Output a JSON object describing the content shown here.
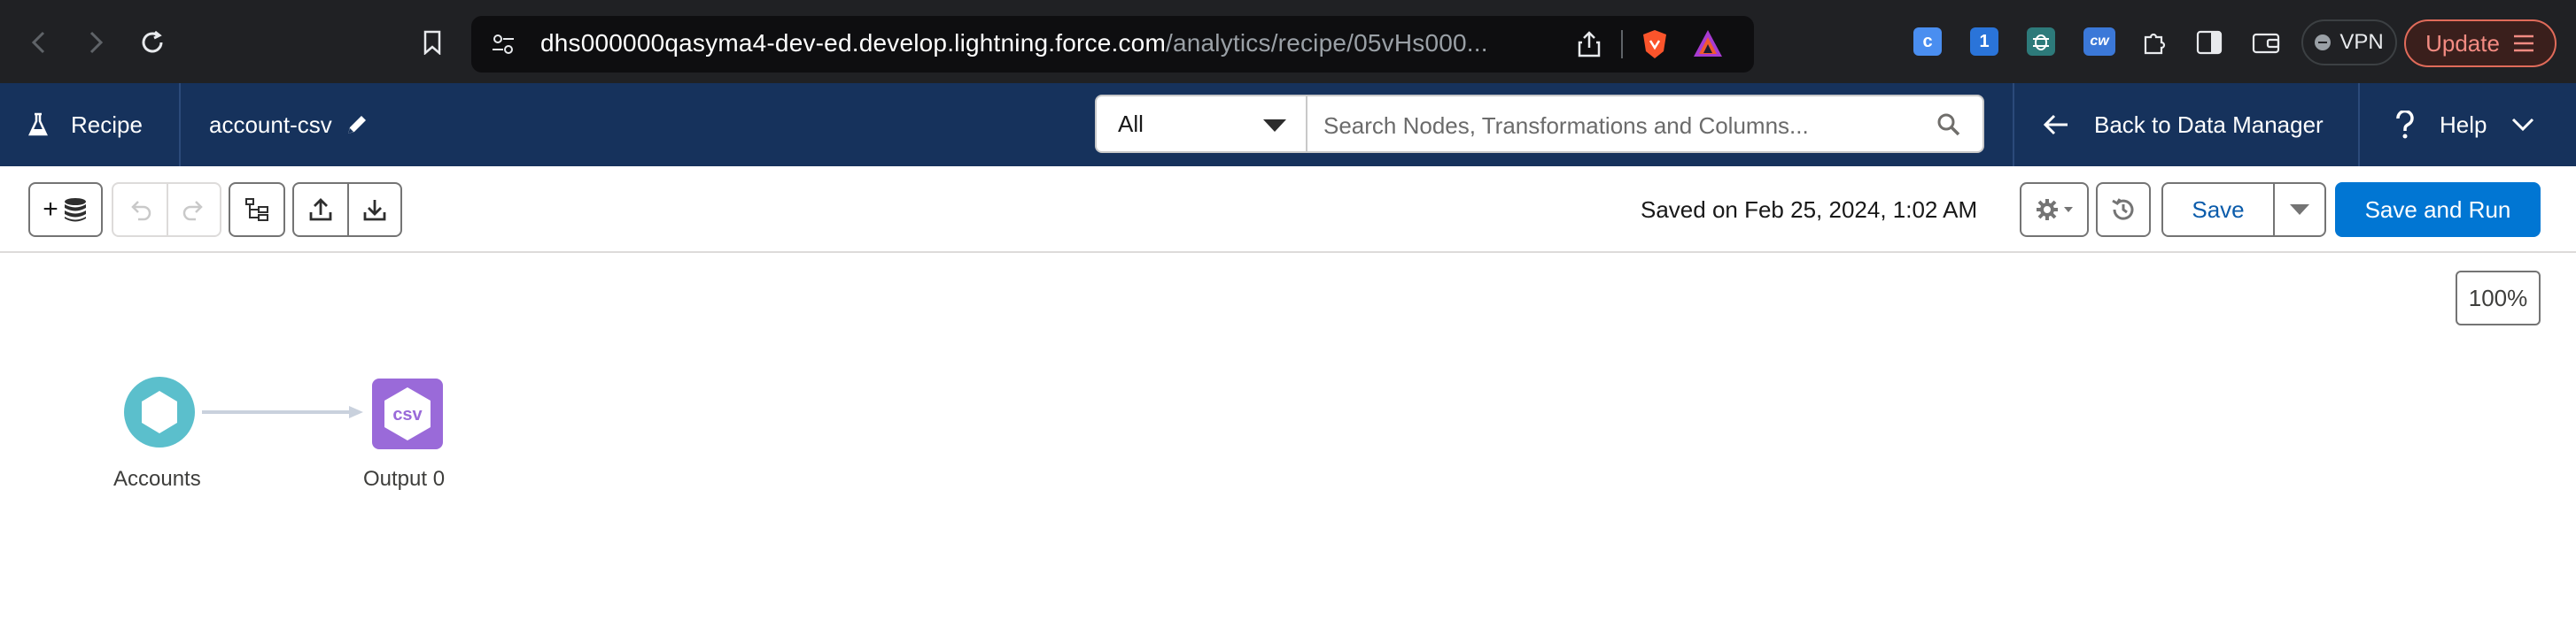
{
  "browser": {
    "url_host": "dhs000000qasyma4-dev-ed.develop.lightning.force.com",
    "url_path": "/analytics/recipe/05vHs000...",
    "ext_c_letter": "c",
    "ext_1password_letter": "1",
    "ext_cw_letters": "cw",
    "vpn_label": "VPN",
    "update_label": "Update"
  },
  "header": {
    "app_label": "Recipe",
    "recipe_name": "account-csv",
    "filter_value": "All",
    "search_placeholder": "Search Nodes, Transformations and Columns...",
    "back_label": "Back to Data Manager",
    "help_label": "Help",
    "background_color": "#16325c"
  },
  "toolbar": {
    "add_data_label": "+",
    "saved_status": "Saved on Feb 25, 2024, 1:02 AM",
    "save_label": "Save",
    "save_and_run_label": "Save and Run",
    "accent_color": "#0176d3"
  },
  "canvas": {
    "zoom_level": "100%",
    "nodes": [
      {
        "label": "Accounts",
        "type": "input",
        "icon": "hexagon-icon",
        "color": "#5bbfcc"
      },
      {
        "label": "Output 0",
        "type": "output",
        "icon": "csv-icon",
        "icon_text": "csv",
        "color": "#9a6ad9"
      }
    ]
  }
}
